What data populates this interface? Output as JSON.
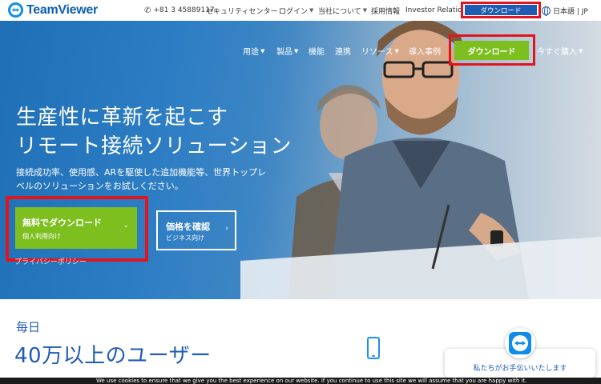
{
  "brand": {
    "name": "TeamViewer",
    "color": "#0e5fb4"
  },
  "topbar": {
    "phone": "+81 3 45889117",
    "security_center": "セキュリティセンター",
    "login": "ログイン",
    "about": "当社について",
    "careers": "採用情報",
    "investor": "Investor Relations",
    "download": "ダウンロード",
    "language": "日本語 | JP"
  },
  "nav": {
    "items": [
      {
        "label": "用途",
        "dropdown": true
      },
      {
        "label": "製品",
        "dropdown": true
      },
      {
        "label": "機能",
        "dropdown": false
      },
      {
        "label": "連携",
        "dropdown": false
      },
      {
        "label": "リソース",
        "dropdown": true
      },
      {
        "label": "導入事例",
        "dropdown": false
      }
    ],
    "download": "ダウンロード",
    "buy_now": "今すぐ購入"
  },
  "hero": {
    "headline_line1": "生産性に革新を起こす",
    "headline_line2": "リモート接続ソリューション",
    "subcopy_line1": "接続成功率、使用感、ARを駆使した追加機能等、世界トップレ",
    "subcopy_line2": "ベルのソリューションをお試しください。",
    "cta_primary_title": "無料でダウンロード",
    "cta_primary_sub": "個人利用向け",
    "cta_secondary_title": "価格を確認",
    "cta_secondary_sub": "ビジネス向け",
    "partial_link": "プライバシーポリシー"
  },
  "section": {
    "daily": "毎日",
    "users": "40万以上のユーザー"
  },
  "chat": {
    "label": "私たちがお手伝いいたします"
  },
  "cookie": {
    "text": "We use cookies to ensure that we give you the best experience on our website. If you continue to use this site we will assume that you are happy with it."
  },
  "colors": {
    "accent_green": "#7cbf1f",
    "highlight_red": "#e2141c",
    "brand_blue": "#1f5cb3"
  }
}
